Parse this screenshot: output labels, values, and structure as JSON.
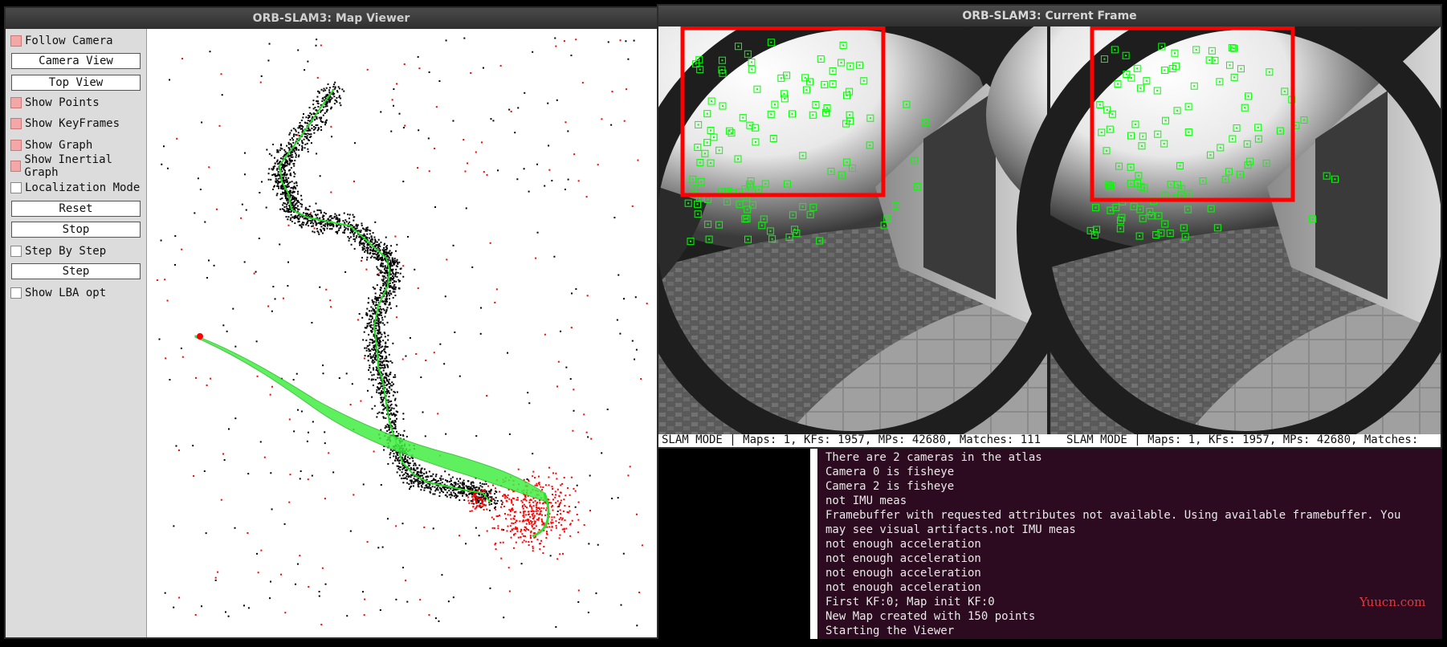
{
  "map_viewer": {
    "title": "ORB-SLAM3: Map Viewer",
    "panel": {
      "follow_camera": "Follow Camera",
      "camera_view": "Camera View",
      "top_view": "Top View",
      "show_points": "Show Points",
      "show_keyframes": "Show KeyFrames",
      "show_graph": "Show Graph",
      "show_inertial_graph": "Show Inertial Graph",
      "localization_mode": "Localization Mode",
      "reset": "Reset",
      "stop": "Stop",
      "step_by_step": "Step By Step",
      "step": "Step",
      "show_lba_opt": "Show LBA opt"
    },
    "checkbox_states": {
      "follow_camera": true,
      "show_points": true,
      "show_keyframes": true,
      "show_graph": true,
      "show_inertial_graph": true,
      "localization_mode": false,
      "step_by_step": false,
      "show_lba_opt": false
    }
  },
  "current_frame": {
    "title": "ORB-SLAM3: Current Frame",
    "status_left": "SLAM MODE |  Maps: 1, KFs: 1957, MPs: 42680, Matches: 111",
    "status_right": "SLAM MODE |  Maps: 1, KFs: 1957, MPs: 42680, Matches:"
  },
  "terminal": {
    "lines": [
      "There are 2 cameras in the atlas",
      "Camera 0 is fisheye",
      "Camera 2 is fisheye",
      "not IMU meas",
      "Framebuffer with requested attributes not available. Using available framebuffer. You",
      " may see visual artifacts.not IMU meas",
      "not enough acceleration",
      "not enough acceleration",
      "not enough acceleration",
      "not enough acceleration",
      "First KF:0; Map init KF:0",
      "New Map created with 150 points",
      "Starting the Viewer"
    ]
  },
  "watermark": "Yuucn.com",
  "colors": {
    "map_point": "#000000",
    "local_map_point": "#ff0000",
    "keyframe_graph": "#22dd22",
    "feature_box": "#00ff00",
    "annotation_box": "#ff0000",
    "terminal_bg": "#2c0a1f"
  }
}
